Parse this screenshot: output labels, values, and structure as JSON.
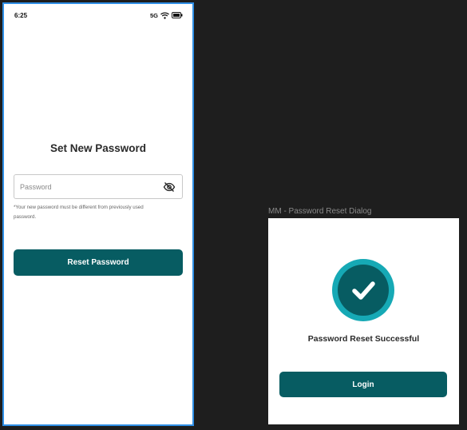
{
  "status_bar": {
    "time": "6:25",
    "network": "5G",
    "wifi_icon": "wifi-icon",
    "battery_icon": "battery-icon"
  },
  "reset_screen": {
    "title": "Set New Password",
    "password_placeholder": "Password",
    "password_value": "",
    "visibility_icon": "eye-off-icon",
    "hint": "*Your new password must be different from previously used password.",
    "button_label": "Reset Password"
  },
  "dialog": {
    "frame_label": "MM - Password Reset Dialog",
    "icon": "check-circle-icon",
    "message": "Password Reset Successful",
    "button_label": "Login"
  },
  "colors": {
    "primary": "#075c62",
    "accent": "#16a9b5",
    "selection_border": "#2f8fe6",
    "canvas": "#1e1e1e"
  }
}
